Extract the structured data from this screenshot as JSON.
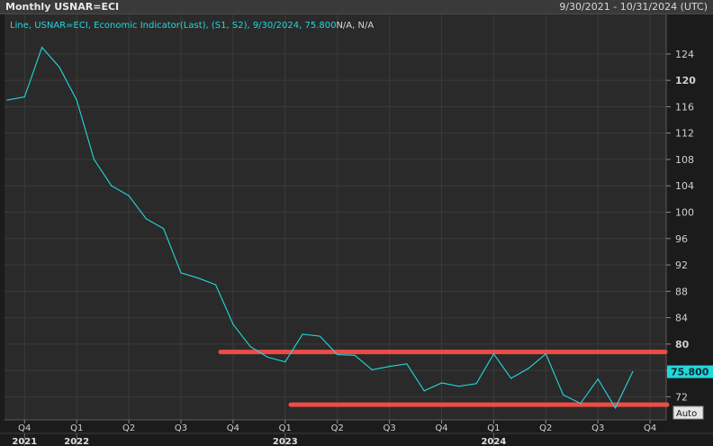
{
  "header": {
    "title": "Monthly USNAR=ECI",
    "date_range": "9/30/2021 - 10/31/2024 (UTC)"
  },
  "legend": {
    "prefix": "Line, USNAR=ECI, Economic Indicator(Last), (S1, S2), 9/30/2024, 75.800",
    "suffix": "N/A, N/A"
  },
  "auto_button": "Auto",
  "last_value_label": "75.800",
  "colors": {
    "line": "#22d8dd",
    "reference_lines": "#ee4b45",
    "background": "#1b1b1b",
    "panel": "#2a2a2a"
  },
  "chart_data": {
    "type": "line",
    "x": [
      "2021-09",
      "2021-10",
      "2021-11",
      "2021-12",
      "2022-01",
      "2022-02",
      "2022-03",
      "2022-04",
      "2022-05",
      "2022-06",
      "2022-07",
      "2022-08",
      "2022-09",
      "2022-10",
      "2022-11",
      "2022-12",
      "2023-01",
      "2023-02",
      "2023-03",
      "2023-04",
      "2023-05",
      "2023-06",
      "2023-07",
      "2023-08",
      "2023-09",
      "2023-10",
      "2023-11",
      "2023-12",
      "2024-01",
      "2024-02",
      "2024-03",
      "2024-04",
      "2024-05",
      "2024-06",
      "2024-07",
      "2024-08",
      "2024-09"
    ],
    "series": [
      {
        "values": [
          117,
          117.5,
          125,
          122,
          117,
          108,
          104,
          102.5,
          99,
          97.5,
          90.8,
          90,
          89,
          83,
          79.6,
          78,
          77.3,
          81.5,
          81.2,
          78.4,
          78.3,
          76.1,
          76.6,
          77,
          72.9,
          74.1,
          73.6,
          74,
          78.5,
          74.8,
          76.3,
          78.5,
          72.3,
          71,
          74.7,
          70.3,
          75.8
        ]
      }
    ],
    "reference_lines": [
      78.8,
      70.8
    ],
    "y_ticks": [
      72,
      76,
      80,
      84,
      88,
      92,
      96,
      100,
      104,
      108,
      112,
      116,
      120,
      124
    ],
    "ylim": [
      68.5,
      130
    ],
    "quarter_ticks": [
      {
        "label": "Q4",
        "date": "2021-10"
      },
      {
        "label": "Q1",
        "date": "2022-01"
      },
      {
        "label": "Q2",
        "date": "2022-04"
      },
      {
        "label": "Q3",
        "date": "2022-07"
      },
      {
        "label": "Q4",
        "date": "2022-10"
      },
      {
        "label": "Q1",
        "date": "2023-01"
      },
      {
        "label": "Q2",
        "date": "2023-04"
      },
      {
        "label": "Q3",
        "date": "2023-07"
      },
      {
        "label": "Q4",
        "date": "2023-10"
      },
      {
        "label": "Q1",
        "date": "2024-01"
      },
      {
        "label": "Q2",
        "date": "2024-04"
      },
      {
        "label": "Q3",
        "date": "2024-07"
      },
      {
        "label": "Q4",
        "date": "2024-10"
      }
    ],
    "year_ticks": [
      {
        "label": "2021",
        "date": "2021-10"
      },
      {
        "label": "2022",
        "date": "2022-01"
      },
      {
        "label": "2023",
        "date": "2023-01"
      },
      {
        "label": "2024",
        "date": "2024-01"
      }
    ],
    "grid": true
  }
}
